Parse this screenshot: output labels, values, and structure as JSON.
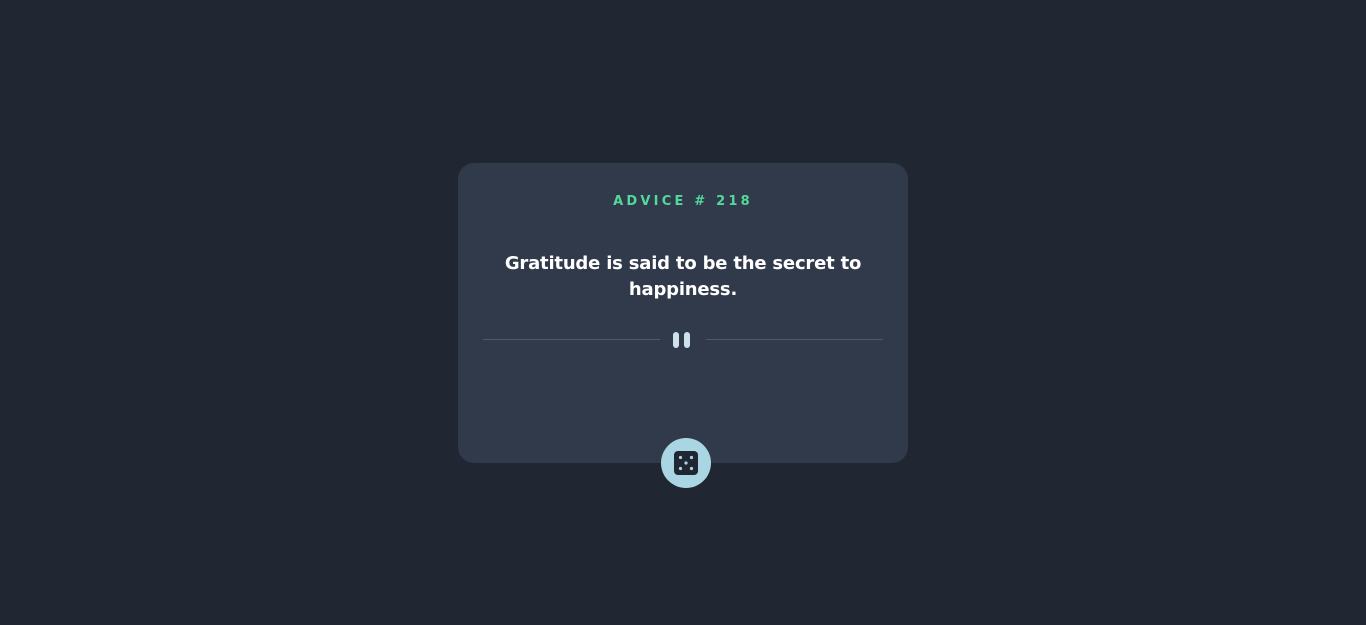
{
  "card": {
    "advice_id": "ADVICE # 218",
    "advice_text": "Gratitude is said to be the secret to happiness."
  },
  "divider": {
    "icon": "pause-icon"
  },
  "button": {
    "icon": "dice-icon"
  },
  "colors": {
    "background": "#202632",
    "card": "#313a4a",
    "accent": "#53d89b",
    "button": "#aad6e4",
    "text": "#ffffff"
  }
}
